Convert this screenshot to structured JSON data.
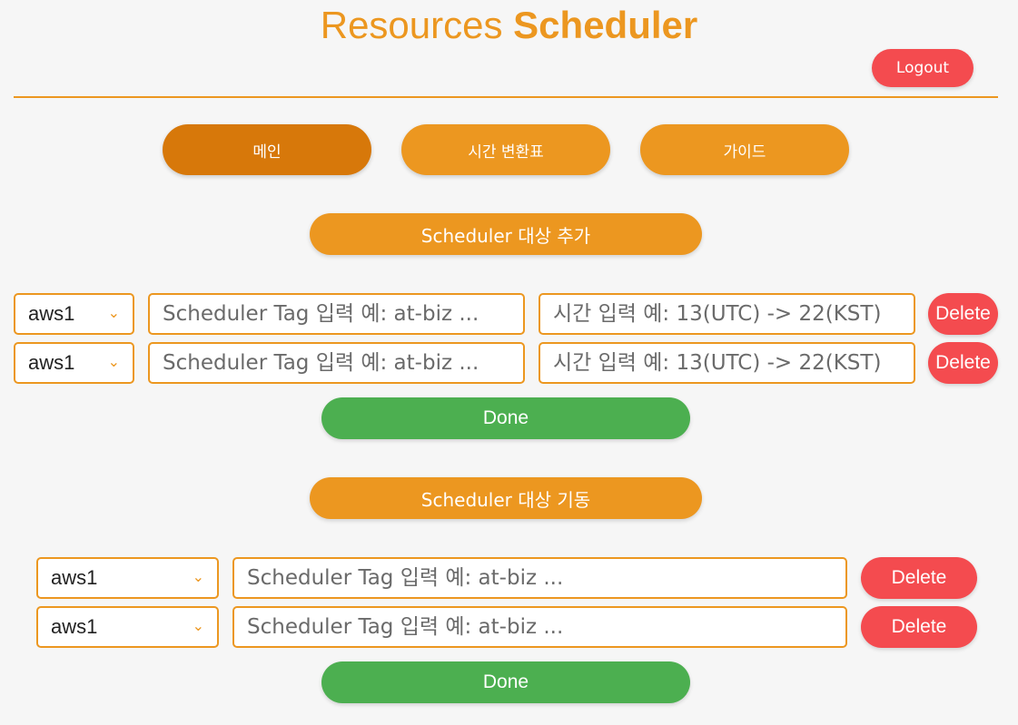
{
  "header": {
    "title_light": "Resources",
    "title_bold": "Scheduler",
    "logout_label": "Logout"
  },
  "nav": {
    "items": [
      {
        "label": "메인",
        "active": true
      },
      {
        "label": "시간 변환표",
        "active": false
      },
      {
        "label": "가이드",
        "active": false
      }
    ]
  },
  "add_section": {
    "button_label": "Scheduler 대상 추가",
    "rows": [
      {
        "account": "aws1",
        "tag_placeholder": "Scheduler Tag 입력 예: at-biz ...",
        "time_placeholder": "시간 입력 예: 13(UTC) -> 22(KST)",
        "delete_label": "Delete"
      },
      {
        "account": "aws1",
        "tag_placeholder": "Scheduler Tag 입력 예: at-biz ...",
        "time_placeholder": "시간 입력 예: 13(UTC) -> 22(KST)",
        "delete_label": "Delete"
      }
    ],
    "done_label": "Done"
  },
  "start_section": {
    "button_label": "Scheduler 대상 기동",
    "rows": [
      {
        "account": "aws1",
        "tag_placeholder": "Scheduler Tag 입력 예: at-biz ...",
        "delete_label": "Delete"
      },
      {
        "account": "aws1",
        "tag_placeholder": "Scheduler Tag 입력 예: at-biz ...",
        "delete_label": "Delete"
      }
    ],
    "done_label": "Done"
  },
  "colors": {
    "accent": "#ec9720",
    "accent_active": "#d7780a",
    "danger": "#f44b4f",
    "success": "#4caf50"
  }
}
